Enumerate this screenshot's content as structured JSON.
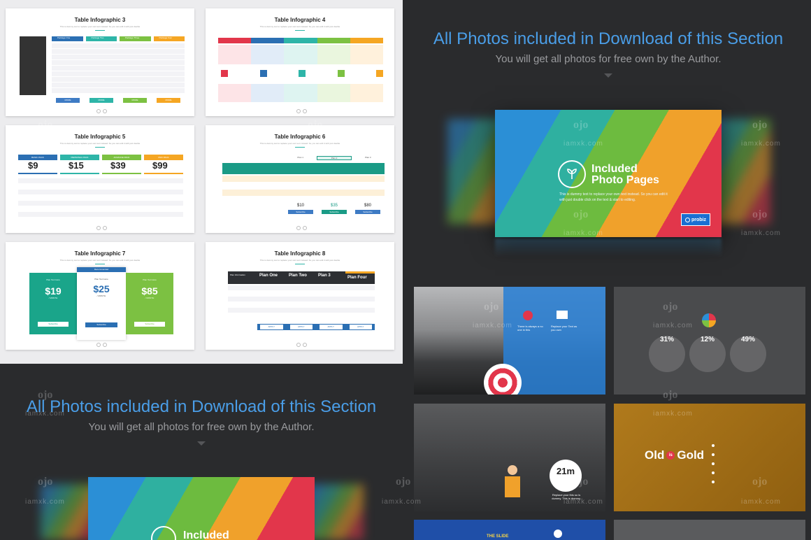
{
  "slides": [
    {
      "title": "Table Infographic 3",
      "subtitle": "This is dummy text to replace your own text instead. So you can edit it with just double"
    },
    {
      "title": "Table Infographic 4",
      "subtitle": "This is dummy text to replace your own text instead. So you can edit it with just double"
    },
    {
      "title": "Table Infographic 5",
      "subtitle": "This is dummy text to replace your own text instead. So you can edit it with just double"
    },
    {
      "title": "Table Infographic 6",
      "subtitle": "This is dummy text to replace your own text instead. So you can edit it with just double"
    },
    {
      "title": "Table Infographic 7",
      "subtitle": "This is dummy text to replace your own text instead. So you can edit it with just double"
    },
    {
      "title": "Table Infographic 8",
      "subtitle": "This is dummy text to replace your own text instead. So you can edit it with just double"
    }
  ],
  "slide3": {
    "headers": [
      "Package One",
      "Package Two",
      "Package Three",
      "Package Four"
    ],
    "buttons": [
      "MORE",
      "MORE",
      "MORE",
      "MORE"
    ]
  },
  "slide5": {
    "headers": [
      "BASIC PACK",
      "PERSONAL PACK",
      "ADVANCE PACK",
      "PRO PACK"
    ],
    "prices": [
      "$9",
      "$15",
      "$39",
      "$99"
    ],
    "per": "PER MONTH"
  },
  "slide6": {
    "plans": [
      "Plan 1",
      "Plan 2",
      "Plan 3"
    ],
    "prices": [
      "$10",
      "$35",
      "$80"
    ],
    "cta": "Subscribe"
  },
  "slide7": {
    "badge": "Recommended",
    "plans": [
      "Plan Text Here",
      "Plan Text Here",
      "Plan Text Here"
    ],
    "prices": [
      "$19",
      "$25",
      "$85"
    ],
    "period": "/ MONTH",
    "cta": "Subscribe"
  },
  "slide8": {
    "headers": [
      "Plan Information",
      "Plan One",
      "Plan Two",
      "Plan 3",
      "Plan Four"
    ],
    "cta": "APPLY"
  },
  "section_heading": {
    "title": "All Photos included in Download of this Section",
    "subtitle": "You will get all photos for free own by the Author."
  },
  "hero": {
    "title_line1": "Included",
    "title_line2": "Photo Pages",
    "text": "This is dummy text to replace your own text instead. So you can edit it with just double click on the text & start to editing.",
    "brand": "probiz"
  },
  "dark_slides": {
    "ds1_label": "There is always a no one in this",
    "ds1_label2": "Replace your Text as you own",
    "ds2_stats": [
      "31%",
      "12%",
      "49%"
    ],
    "ds3_time": "21m",
    "ds3_caption": "Replace your this so is dummy. This is dummy.",
    "ds4_title_a": "Old",
    "ds4_title_is": "is",
    "ds4_title_b": "Gold",
    "ds5_title": "THE SLIDE"
  },
  "watermark": {
    "logo": "ojo",
    "domain": "iamxk.com"
  }
}
